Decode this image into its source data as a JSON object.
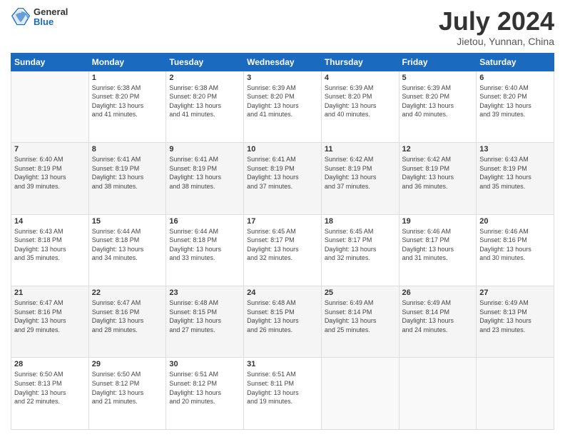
{
  "header": {
    "logo_line1": "General",
    "logo_line2": "Blue",
    "title": "July 2024",
    "subtitle": "Jietou, Yunnan, China"
  },
  "days_of_week": [
    "Sunday",
    "Monday",
    "Tuesday",
    "Wednesday",
    "Thursday",
    "Friday",
    "Saturday"
  ],
  "weeks": [
    [
      {
        "day": "",
        "info": ""
      },
      {
        "day": "1",
        "info": "Sunrise: 6:38 AM\nSunset: 8:20 PM\nDaylight: 13 hours\nand 41 minutes."
      },
      {
        "day": "2",
        "info": "Sunrise: 6:38 AM\nSunset: 8:20 PM\nDaylight: 13 hours\nand 41 minutes."
      },
      {
        "day": "3",
        "info": "Sunrise: 6:39 AM\nSunset: 8:20 PM\nDaylight: 13 hours\nand 41 minutes."
      },
      {
        "day": "4",
        "info": "Sunrise: 6:39 AM\nSunset: 8:20 PM\nDaylight: 13 hours\nand 40 minutes."
      },
      {
        "day": "5",
        "info": "Sunrise: 6:39 AM\nSunset: 8:20 PM\nDaylight: 13 hours\nand 40 minutes."
      },
      {
        "day": "6",
        "info": "Sunrise: 6:40 AM\nSunset: 8:20 PM\nDaylight: 13 hours\nand 39 minutes."
      }
    ],
    [
      {
        "day": "7",
        "info": "Sunrise: 6:40 AM\nSunset: 8:19 PM\nDaylight: 13 hours\nand 39 minutes."
      },
      {
        "day": "8",
        "info": "Sunrise: 6:41 AM\nSunset: 8:19 PM\nDaylight: 13 hours\nand 38 minutes."
      },
      {
        "day": "9",
        "info": "Sunrise: 6:41 AM\nSunset: 8:19 PM\nDaylight: 13 hours\nand 38 minutes."
      },
      {
        "day": "10",
        "info": "Sunrise: 6:41 AM\nSunset: 8:19 PM\nDaylight: 13 hours\nand 37 minutes."
      },
      {
        "day": "11",
        "info": "Sunrise: 6:42 AM\nSunset: 8:19 PM\nDaylight: 13 hours\nand 37 minutes."
      },
      {
        "day": "12",
        "info": "Sunrise: 6:42 AM\nSunset: 8:19 PM\nDaylight: 13 hours\nand 36 minutes."
      },
      {
        "day": "13",
        "info": "Sunrise: 6:43 AM\nSunset: 8:19 PM\nDaylight: 13 hours\nand 35 minutes."
      }
    ],
    [
      {
        "day": "14",
        "info": "Sunrise: 6:43 AM\nSunset: 8:18 PM\nDaylight: 13 hours\nand 35 minutes."
      },
      {
        "day": "15",
        "info": "Sunrise: 6:44 AM\nSunset: 8:18 PM\nDaylight: 13 hours\nand 34 minutes."
      },
      {
        "day": "16",
        "info": "Sunrise: 6:44 AM\nSunset: 8:18 PM\nDaylight: 13 hours\nand 33 minutes."
      },
      {
        "day": "17",
        "info": "Sunrise: 6:45 AM\nSunset: 8:17 PM\nDaylight: 13 hours\nand 32 minutes."
      },
      {
        "day": "18",
        "info": "Sunrise: 6:45 AM\nSunset: 8:17 PM\nDaylight: 13 hours\nand 32 minutes."
      },
      {
        "day": "19",
        "info": "Sunrise: 6:46 AM\nSunset: 8:17 PM\nDaylight: 13 hours\nand 31 minutes."
      },
      {
        "day": "20",
        "info": "Sunrise: 6:46 AM\nSunset: 8:16 PM\nDaylight: 13 hours\nand 30 minutes."
      }
    ],
    [
      {
        "day": "21",
        "info": "Sunrise: 6:47 AM\nSunset: 8:16 PM\nDaylight: 13 hours\nand 29 minutes."
      },
      {
        "day": "22",
        "info": "Sunrise: 6:47 AM\nSunset: 8:16 PM\nDaylight: 13 hours\nand 28 minutes."
      },
      {
        "day": "23",
        "info": "Sunrise: 6:48 AM\nSunset: 8:15 PM\nDaylight: 13 hours\nand 27 minutes."
      },
      {
        "day": "24",
        "info": "Sunrise: 6:48 AM\nSunset: 8:15 PM\nDaylight: 13 hours\nand 26 minutes."
      },
      {
        "day": "25",
        "info": "Sunrise: 6:49 AM\nSunset: 8:14 PM\nDaylight: 13 hours\nand 25 minutes."
      },
      {
        "day": "26",
        "info": "Sunrise: 6:49 AM\nSunset: 8:14 PM\nDaylight: 13 hours\nand 24 minutes."
      },
      {
        "day": "27",
        "info": "Sunrise: 6:49 AM\nSunset: 8:13 PM\nDaylight: 13 hours\nand 23 minutes."
      }
    ],
    [
      {
        "day": "28",
        "info": "Sunrise: 6:50 AM\nSunset: 8:13 PM\nDaylight: 13 hours\nand 22 minutes."
      },
      {
        "day": "29",
        "info": "Sunrise: 6:50 AM\nSunset: 8:12 PM\nDaylight: 13 hours\nand 21 minutes."
      },
      {
        "day": "30",
        "info": "Sunrise: 6:51 AM\nSunset: 8:12 PM\nDaylight: 13 hours\nand 20 minutes."
      },
      {
        "day": "31",
        "info": "Sunrise: 6:51 AM\nSunset: 8:11 PM\nDaylight: 13 hours\nand 19 minutes."
      },
      {
        "day": "",
        "info": ""
      },
      {
        "day": "",
        "info": ""
      },
      {
        "day": "",
        "info": ""
      }
    ]
  ]
}
